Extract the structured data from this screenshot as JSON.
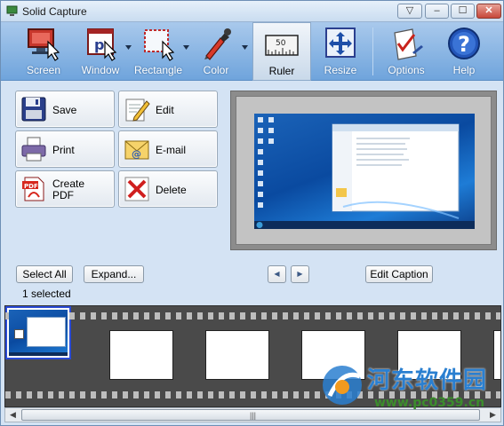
{
  "window": {
    "title": "Solid Capture",
    "close_glyph": "✕",
    "max_glyph": "☐",
    "min_glyph": "–",
    "menu_glyph": "▽"
  },
  "toolbar": {
    "items": [
      {
        "label": "Screen",
        "icon": "screen-capture-icon"
      },
      {
        "label": "Window",
        "icon": "window-capture-icon"
      },
      {
        "label": "Rectangle",
        "icon": "rectangle-capture-icon"
      },
      {
        "label": "Color",
        "icon": "color-picker-icon"
      },
      {
        "label": "Ruler",
        "icon": "ruler-icon",
        "ruler_value": "50"
      },
      {
        "label": "Resize",
        "icon": "resize-arrows-icon"
      },
      {
        "label": "Options",
        "icon": "options-checklist-icon"
      },
      {
        "label": "Help",
        "icon": "help-question-icon"
      }
    ]
  },
  "actions": [
    {
      "label": "Save",
      "icon": "floppy-disk-icon"
    },
    {
      "label": "Edit",
      "icon": "edit-pencil-icon"
    },
    {
      "label": "Print",
      "icon": "printer-icon"
    },
    {
      "label": "E-mail",
      "icon": "email-envelope-icon"
    },
    {
      "label": "Create PDF",
      "icon": "pdf-file-icon"
    },
    {
      "label": "Delete",
      "icon": "delete-x-icon"
    }
  ],
  "pdf_badge": "PDF",
  "controls": {
    "select_all": "Select All",
    "expand": "Expand...",
    "prev_glyph": "◀",
    "next_glyph": "▶",
    "edit_caption": "Edit Caption",
    "selected_text": "1 selected"
  },
  "filmstrip": {
    "frames": 6,
    "selected_index": 0
  },
  "scrollbar": {
    "left_glyph": "◀",
    "right_glyph": "▶",
    "grip": "|||"
  },
  "watermark": {
    "text": "河东软件园",
    "url": "www.pc0359.cn"
  },
  "colors": {
    "toolbar": "#6fa4dc",
    "panel": "#d4e3f4",
    "selection": "#2a4bd6"
  }
}
